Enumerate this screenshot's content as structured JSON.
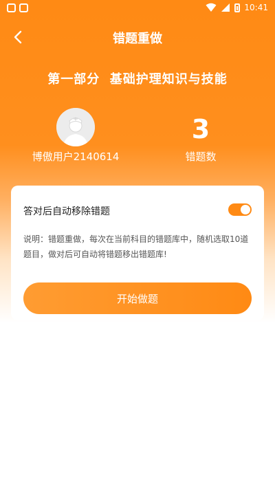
{
  "status_bar": {
    "time": "10:41"
  },
  "header": {
    "title": "错题重做"
  },
  "section": {
    "title": "第一部分  基础护理知识与技能"
  },
  "profile": {
    "username": "博傲用户2140614"
  },
  "stats": {
    "error_count": "3",
    "error_count_label": "错题数"
  },
  "settings": {
    "auto_remove_label": "答对后自动移除错题",
    "auto_remove_enabled": true,
    "description": "说明：错题重做，每次在当前科目的错题库中，随机选取10道题目，做对后可自动将错题移出错题库!"
  },
  "actions": {
    "start_label": "开始做题"
  },
  "colors": {
    "accent": "#ff8a14",
    "card": "#ffffff",
    "text": "#222222",
    "muted": "#555555"
  },
  "icons": [
    "back-icon",
    "avatar-icon",
    "wifi-icon",
    "signal-icon",
    "battery-icon"
  ]
}
